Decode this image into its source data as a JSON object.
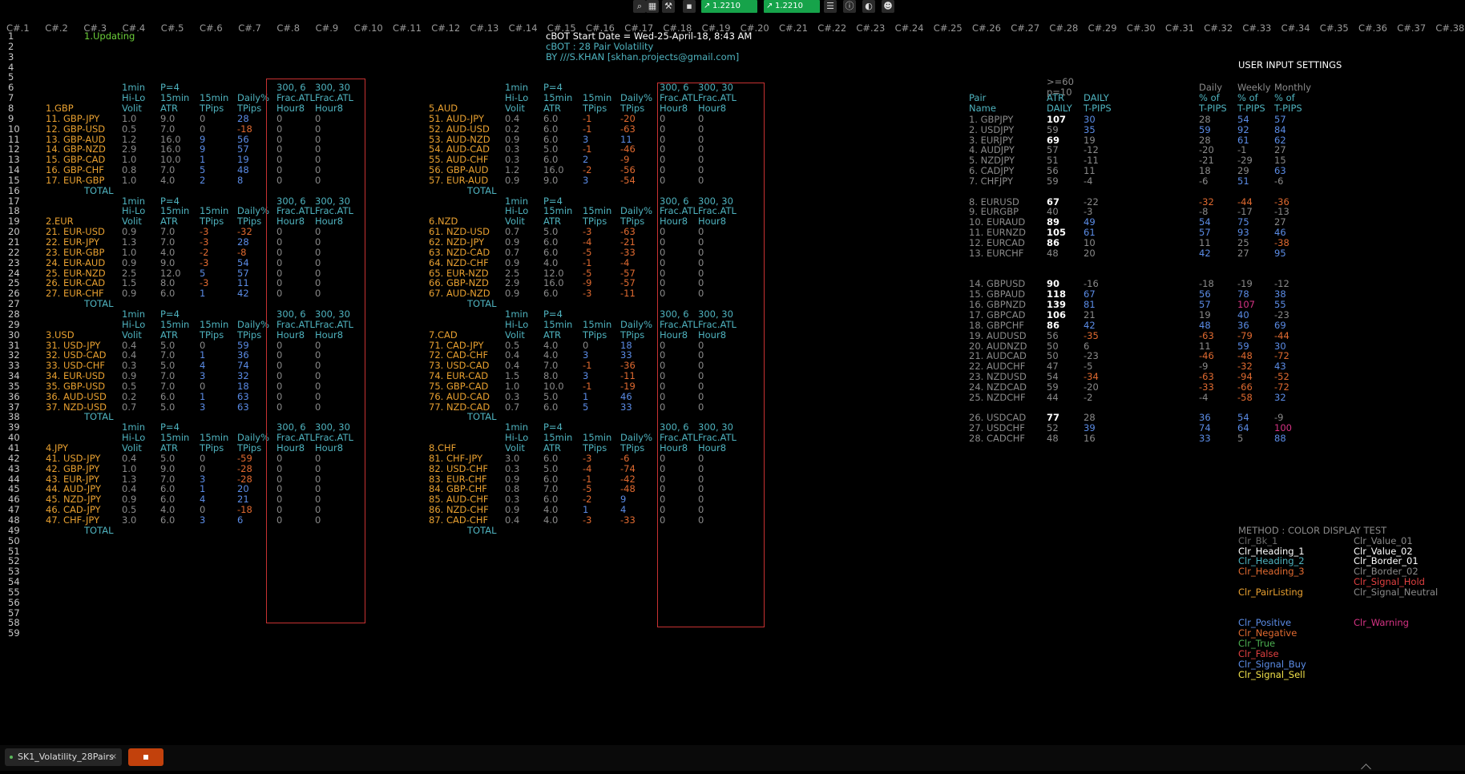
{
  "toolbar": {
    "icons": [
      "search-icon",
      "chart-icon",
      "tools-icon",
      "box-icon"
    ],
    "price1": "1.2210",
    "price2": "1.2210",
    "right_icons": [
      "list-icon",
      "info-icon",
      "profile-icon",
      "user-icon"
    ]
  },
  "column_headers": [
    "C#.1",
    "C#.2",
    "C#.3",
    "C#.4",
    "C#.5",
    "C#.6",
    "C#.7",
    "C#.8",
    "C#.9",
    "C#.10",
    "C#.11",
    "C#.12",
    "C#.13",
    "C#.14",
    "C#.15",
    "C#.16",
    "C#.17",
    "C#.18",
    "C#.19",
    "C#.20",
    "C#.21",
    "C#.22",
    "C#.23",
    "C#.24",
    "C#.25",
    "C#.26",
    "C#.27",
    "C#.28",
    "C#.29",
    "C#.30",
    "C#.31",
    "C#.32",
    "C#.33",
    "C#.34",
    "C#.35",
    "C#.36",
    "C#.37",
    "C#.38"
  ],
  "row_numbers": [
    "1",
    "2",
    "3",
    "4",
    "5",
    "6",
    "7",
    "8",
    "9",
    "10",
    "11",
    "12",
    "13",
    "14",
    "15",
    "16",
    "17",
    "18",
    "19",
    "20",
    "21",
    "22",
    "23",
    "24",
    "25",
    "26",
    "27",
    "28",
    "29",
    "30",
    "31",
    "32",
    "33",
    "34",
    "35",
    "36",
    "37",
    "38",
    "39",
    "40",
    "41",
    "42",
    "43",
    "44",
    "45",
    "46",
    "47",
    "48",
    "49",
    "50",
    "51",
    "52",
    "53",
    "54",
    "55",
    "56",
    "57",
    "58",
    "59"
  ],
  "status": "1.Updating",
  "info": {
    "line1": "cBOT Start Date = Wed-25-April-18,  8:43 AM",
    "line2": "cBOT : 28 Pair Volatility",
    "line3": "BY   ///S.KHAN  [skhan.projects@gmail.com]"
  },
  "user_input_title": "USER INPUT SETTINGS",
  "header_labels": {
    "r6": [
      "1min",
      "P=4",
      "",
      "",
      "300, 6",
      "300, 30"
    ],
    "r7": [
      "Hi-Lo",
      "15min",
      "15min",
      "Daily%",
      "Frac.ATL",
      "Frac.ATL"
    ],
    "r8": [
      "Volit",
      "ATR",
      "TPips",
      "TPips",
      "Hour8",
      "Hour8"
    ]
  },
  "total_label": "TOTAL",
  "groups": [
    {
      "name": "1.GBP",
      "rows": [
        [
          "11. GBP-JPY",
          "1.0",
          "9.0",
          "0",
          "28",
          "0",
          "0"
        ],
        [
          "12. GBP-USD",
          "0.5",
          "7.0",
          "0",
          "-18",
          "0",
          "0"
        ],
        [
          "13. GBP-AUD",
          "1.2",
          "16.0",
          "9",
          "56",
          "0",
          "0"
        ],
        [
          "14. GBP-NZD",
          "2.9",
          "16.0",
          "9",
          "57",
          "0",
          "0"
        ],
        [
          "15. GBP-CAD",
          "1.0",
          "10.0",
          "1",
          "19",
          "0",
          "0"
        ],
        [
          "16. GBP-CHF",
          "0.8",
          "7.0",
          "5",
          "48",
          "0",
          "0"
        ],
        [
          "17. EUR-GBP",
          "1.0",
          "4.0",
          "2",
          "8",
          "0",
          "0"
        ]
      ]
    },
    {
      "name": "2.EUR",
      "rows": [
        [
          "21. EUR-USD",
          "0.9",
          "7.0",
          "-3",
          "-32",
          "0",
          "0"
        ],
        [
          "22. EUR-JPY",
          "1.3",
          "7.0",
          "-3",
          "28",
          "0",
          "0"
        ],
        [
          "23. EUR-GBP",
          "1.0",
          "4.0",
          "-2",
          "-8",
          "0",
          "0"
        ],
        [
          "24. EUR-AUD",
          "0.9",
          "9.0",
          "-3",
          "54",
          "0",
          "0"
        ],
        [
          "25. EUR-NZD",
          "2.5",
          "12.0",
          "5",
          "57",
          "0",
          "0"
        ],
        [
          "26. EUR-CAD",
          "1.5",
          "8.0",
          "-3",
          "11",
          "0",
          "0"
        ],
        [
          "27. EUR-CHF",
          "0.9",
          "6.0",
          "1",
          "42",
          "0",
          "0"
        ]
      ]
    },
    {
      "name": "3.USD",
      "rows": [
        [
          "31. USD-JPY",
          "0.4",
          "5.0",
          "0",
          "59",
          "0",
          "0"
        ],
        [
          "32. USD-CAD",
          "0.4",
          "7.0",
          "1",
          "36",
          "0",
          "0"
        ],
        [
          "33. USD-CHF",
          "0.3",
          "5.0",
          "4",
          "74",
          "0",
          "0"
        ],
        [
          "34. EUR-USD",
          "0.9",
          "7.0",
          "3",
          "32",
          "0",
          "0"
        ],
        [
          "35. GBP-USD",
          "0.5",
          "7.0",
          "0",
          "18",
          "0",
          "0"
        ],
        [
          "36. AUD-USD",
          "0.2",
          "6.0",
          "1",
          "63",
          "0",
          "0"
        ],
        [
          "37. NZD-USD",
          "0.7",
          "5.0",
          "3",
          "63",
          "0",
          "0"
        ]
      ]
    },
    {
      "name": "4.JPY",
      "rows": [
        [
          "41. USD-JPY",
          "0.4",
          "5.0",
          "0",
          "-59",
          "0",
          "0"
        ],
        [
          "42. GBP-JPY",
          "1.0",
          "9.0",
          "0",
          "-28",
          "0",
          "0"
        ],
        [
          "43. EUR-JPY",
          "1.3",
          "7.0",
          "3",
          "-28",
          "0",
          "0"
        ],
        [
          "44. AUD-JPY",
          "0.4",
          "6.0",
          "1",
          "20",
          "0",
          "0"
        ],
        [
          "45. NZD-JPY",
          "0.9",
          "6.0",
          "4",
          "21",
          "0",
          "0"
        ],
        [
          "46. CAD-JPY",
          "0.5",
          "4.0",
          "0",
          "-18",
          "0",
          "0"
        ],
        [
          "47. CHF-JPY",
          "3.0",
          "6.0",
          "3",
          "6",
          "0",
          "0"
        ]
      ]
    },
    {
      "name": "5.AUD",
      "rows": [
        [
          "51. AUD-JPY",
          "0.4",
          "6.0",
          "-1",
          "-20",
          "0",
          "0"
        ],
        [
          "52. AUD-USD",
          "0.2",
          "6.0",
          "-1",
          "-63",
          "0",
          "0"
        ],
        [
          "53. AUD-NZD",
          "0.9",
          "6.0",
          "3",
          "11",
          "0",
          "0"
        ],
        [
          "54. AUD-CAD",
          "0.3",
          "5.0",
          "-1",
          "-46",
          "0",
          "0"
        ],
        [
          "55. AUD-CHF",
          "0.3",
          "6.0",
          "2",
          "-9",
          "0",
          "0"
        ],
        [
          "56. GBP-AUD",
          "1.2",
          "16.0",
          "-2",
          "-56",
          "0",
          "0"
        ],
        [
          "57. EUR-AUD",
          "0.9",
          "9.0",
          "3",
          "-54",
          "0",
          "0"
        ]
      ]
    },
    {
      "name": "6.NZD",
      "rows": [
        [
          "61. NZD-USD",
          "0.7",
          "5.0",
          "-3",
          "-63",
          "0",
          "0"
        ],
        [
          "62. NZD-JPY",
          "0.9",
          "6.0",
          "-4",
          "-21",
          "0",
          "0"
        ],
        [
          "63. NZD-CAD",
          "0.7",
          "6.0",
          "-5",
          "-33",
          "0",
          "0"
        ],
        [
          "64. NZD-CHF",
          "0.9",
          "4.0",
          "-1",
          "-4",
          "0",
          "0"
        ],
        [
          "65. EUR-NZD",
          "2.5",
          "12.0",
          "-5",
          "-57",
          "0",
          "0"
        ],
        [
          "66. GBP-NZD",
          "2.9",
          "16.0",
          "-9",
          "-57",
          "0",
          "0"
        ],
        [
          "67. AUD-NZD",
          "0.9",
          "6.0",
          "-3",
          "-11",
          "0",
          "0"
        ]
      ]
    },
    {
      "name": "7.CAD",
      "rows": [
        [
          "71. CAD-JPY",
          "0.5",
          "4.0",
          "0",
          "18",
          "0",
          "0"
        ],
        [
          "72. CAD-CHF",
          "0.4",
          "4.0",
          "3",
          "33",
          "0",
          "0"
        ],
        [
          "73. USD-CAD",
          "0.4",
          "7.0",
          "-1",
          "-36",
          "0",
          "0"
        ],
        [
          "74. EUR-CAD",
          "1.5",
          "8.0",
          "3",
          "-11",
          "0",
          "0"
        ],
        [
          "75. GBP-CAD",
          "1.0",
          "10.0",
          "-1",
          "-19",
          "0",
          "0"
        ],
        [
          "76. AUD-CAD",
          "0.3",
          "5.0",
          "1",
          "46",
          "0",
          "0"
        ],
        [
          "77. NZD-CAD",
          "0.7",
          "6.0",
          "5",
          "33",
          "0",
          "0"
        ]
      ]
    },
    {
      "name": "8.CHF",
      "rows": [
        [
          "81. CHF-JPY",
          "3.0",
          "6.0",
          "-3",
          "-6",
          "0",
          "0"
        ],
        [
          "82. USD-CHF",
          "0.3",
          "5.0",
          "-4",
          "-74",
          "0",
          "0"
        ],
        [
          "83. EUR-CHF",
          "0.9",
          "6.0",
          "-1",
          "-42",
          "0",
          "0"
        ],
        [
          "84. GBP-CHF",
          "0.8",
          "7.0",
          "-5",
          "-48",
          "0",
          "0"
        ],
        [
          "85. AUD-CHF",
          "0.3",
          "6.0",
          "-2",
          "9",
          "0",
          "0"
        ],
        [
          "86. NZD-CHF",
          "0.9",
          "4.0",
          "1",
          "4",
          "0",
          "0"
        ],
        [
          "87. CAD-CHF",
          "0.4",
          "4.0",
          "-3",
          "-33",
          "0",
          "0"
        ]
      ]
    }
  ],
  "summary": {
    "header_top": [
      ">=60",
      "p=10"
    ],
    "headers_r7": [
      "Pair",
      "ATR",
      "DAILY",
      "Daily",
      "Weekly",
      "Monthly"
    ],
    "headers_r8": [
      "Name",
      "DAILY",
      "T-PIPS",
      "% of",
      "% of",
      "% of"
    ],
    "headers_r9": [
      "T-PIPS",
      "T-PIPS",
      "T-PIPS"
    ],
    "blocks": [
      [
        [
          "1. GBPJPY",
          "107",
          "30",
          "28",
          "54",
          "57"
        ],
        [
          "2. USDJPY",
          "59",
          "35",
          "59",
          "92",
          "84"
        ],
        [
          "3. EURJPY",
          "69",
          "19",
          "28",
          "61",
          "62"
        ],
        [
          "4. AUDJPY",
          "57",
          "-12",
          "-20",
          "-1",
          "27"
        ],
        [
          "5. NZDJPY",
          "51",
          "-11",
          "-21",
          "-29",
          "15"
        ],
        [
          "6. CADJPY",
          "56",
          "11",
          "18",
          "29",
          "63"
        ],
        [
          "7. CHFJPY",
          "59",
          "-4",
          "-6",
          "51",
          "-6"
        ]
      ],
      [
        [
          "8. EURUSD",
          "67",
          "-22",
          "-32",
          "-44",
          "-36"
        ],
        [
          "9. EURGBP",
          "40",
          "-3",
          "-8",
          "-17",
          "-13"
        ],
        [
          "10. EURAUD",
          "89",
          "49",
          "54",
          "75",
          "27"
        ],
        [
          "11. EURNZD",
          "105",
          "61",
          "57",
          "93",
          "46"
        ],
        [
          "12. EURCAD",
          "86",
          "10",
          "11",
          "25",
          "-38"
        ],
        [
          "13. EURCHF",
          "48",
          "20",
          "42",
          "27",
          "95"
        ]
      ],
      [
        [
          "14. GBPUSD",
          "90",
          "-16",
          "-18",
          "-19",
          "-12"
        ],
        [
          "15. GBPAUD",
          "118",
          "67",
          "56",
          "78",
          "38"
        ],
        [
          "16. GBPNZD",
          "139",
          "81",
          "57",
          "107",
          "55"
        ],
        [
          "17. GBPCAD",
          "106",
          "21",
          "19",
          "40",
          "-23"
        ],
        [
          "18. GBPCHF",
          "86",
          "42",
          "48",
          "36",
          "69"
        ]
      ],
      [
        [
          "19. AUDUSD",
          "56",
          "-35",
          "-63",
          "-79",
          "-44"
        ],
        [
          "20. AUDNZD",
          "50",
          "6",
          "11",
          "59",
          "30"
        ],
        [
          "21. AUDCAD",
          "50",
          "-23",
          "-46",
          "-48",
          "-72"
        ],
        [
          "22. AUDCHF",
          "47",
          "-5",
          "-9",
          "-32",
          "43"
        ]
      ],
      [
        [
          "23. NZDUSD",
          "54",
          "-34",
          "-63",
          "-94",
          "-52"
        ],
        [
          "24. NZDCAD",
          "59",
          "-20",
          "-33",
          "-66",
          "-72"
        ],
        [
          "25. NZDCHF",
          "44",
          "-2",
          "-4",
          "-58",
          "32"
        ]
      ],
      [
        [
          "26. USDCAD",
          "77",
          "28",
          "36",
          "54",
          "-9"
        ],
        [
          "27. USDCHF",
          "52",
          "39",
          "74",
          "64",
          "100"
        ],
        [
          "28. CADCHF",
          "48",
          "16",
          "33",
          "5",
          "88"
        ]
      ]
    ]
  },
  "color_test": {
    "title": "METHOD : COLOR DISPLAY TEST",
    "left": [
      {
        "label": "Clr_Bk_1",
        "color": "#6b6b6b"
      },
      {
        "label": "Clr_Heading_1",
        "color": "#ffffff"
      },
      {
        "label": "Clr_Heading_2",
        "color": "#4fb3bf"
      },
      {
        "label": "Clr_Heading_3",
        "color": "#e06a30"
      },
      {
        "label": "",
        "color": "#000"
      },
      {
        "label": "Clr_PairListing",
        "color": "#e8a030"
      },
      {
        "label": "",
        "color": "#000"
      },
      {
        "label": "",
        "color": "#000"
      },
      {
        "label": "Clr_Positive",
        "color": "#5b8ce6"
      },
      {
        "label": "Clr_Negative",
        "color": "#e06a30"
      },
      {
        "label": "Clr_True",
        "color": "#4caf50"
      },
      {
        "label": "Clr_False",
        "color": "#e04040"
      },
      {
        "label": "Clr_Signal_Buy",
        "color": "#5b8ce6"
      },
      {
        "label": "Clr_Signal_Sell",
        "color": "#f2e24a"
      }
    ],
    "right": [
      {
        "label": "Clr_Value_01",
        "color": "#8a8a8a"
      },
      {
        "label": "Clr_Value_02",
        "color": "#ffffff"
      },
      {
        "label": "Clr_Border_01",
        "color": "#ffffff"
      },
      {
        "label": "Clr_Border_02",
        "color": "#8a8a8a"
      },
      {
        "label": "Clr_Signal_Hold",
        "color": "#e04040"
      },
      {
        "label": "Clr_Signal_Neutral",
        "color": "#8a8a8a"
      },
      {
        "label": "",
        "color": "#000"
      },
      {
        "label": "",
        "color": "#000"
      },
      {
        "label": "Clr_Warning",
        "color": "#d63384"
      }
    ]
  },
  "colors": {
    "row_number": "#c8c8c8",
    "header": "#4fb3bf",
    "group": "#e8a030",
    "pair": "#e8a030",
    "value": "#8a8a8a",
    "positive": "#5b8ce6",
    "negative": "#e06a30",
    "strong": "#ffffff",
    "info": "#ffffff",
    "info_alt": "#4fb3bf",
    "status": "#6ccf3a",
    "total": "#4fb3bf",
    "extreme": "#d63384"
  },
  "tabs": {
    "tab1": "SK1_Volatility_28Pairs",
    "tab1_close": "×"
  }
}
